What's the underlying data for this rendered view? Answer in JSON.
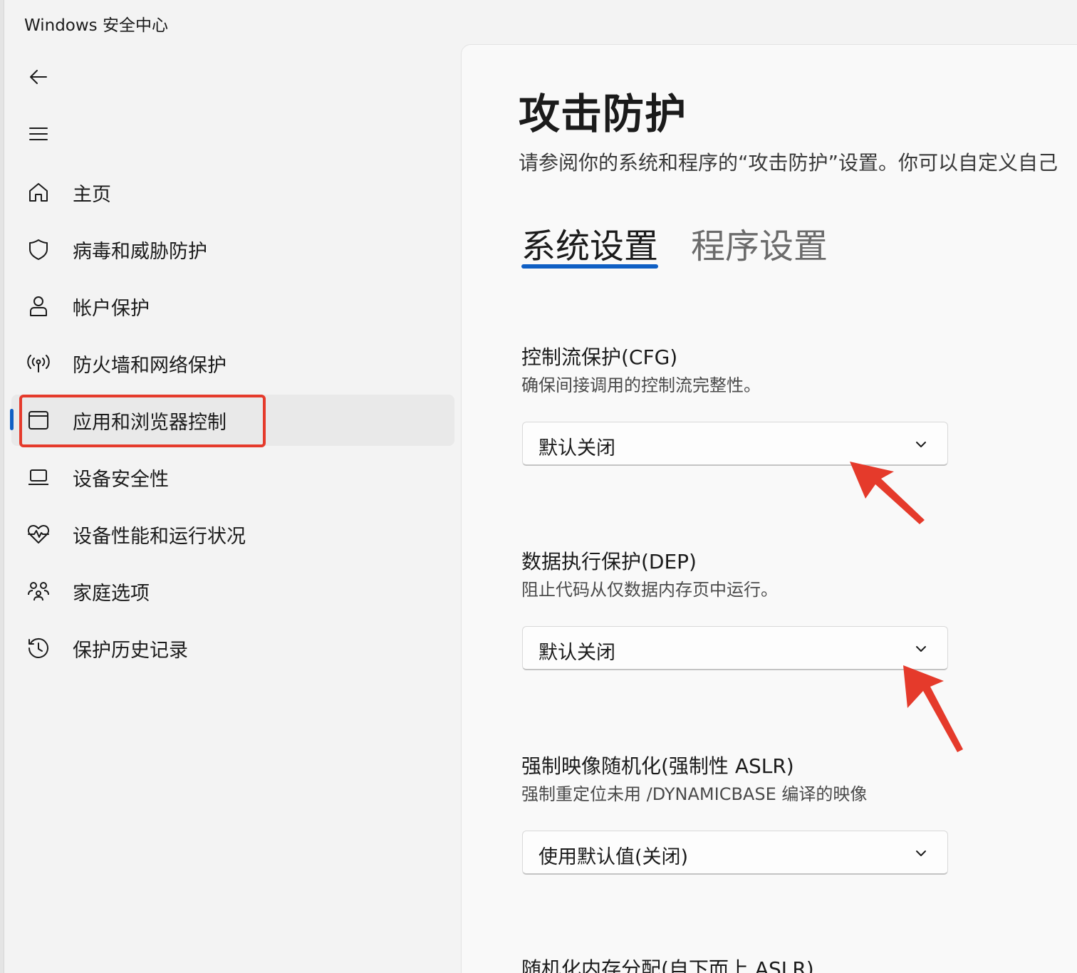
{
  "app": {
    "title": "Windows 安全中心"
  },
  "nav": {
    "back": "back-arrow-icon",
    "menu": "hamburger-menu-icon",
    "items": [
      {
        "label": "主页",
        "icon": "home-icon"
      },
      {
        "label": "病毒和威胁防护",
        "icon": "shield-icon"
      },
      {
        "label": "帐户保护",
        "icon": "person-icon"
      },
      {
        "label": "防火墙和网络保护",
        "icon": "antenna-icon"
      },
      {
        "label": "应用和浏览器控制",
        "icon": "app-window-icon",
        "selected": true
      },
      {
        "label": "设备安全性",
        "icon": "laptop-icon"
      },
      {
        "label": "设备性能和运行状况",
        "icon": "heart-pulse-icon"
      },
      {
        "label": "家庭选项",
        "icon": "family-icon"
      },
      {
        "label": "保护历史记录",
        "icon": "history-icon"
      }
    ]
  },
  "main": {
    "title": "攻击防护",
    "description": "请参阅你的系统和程序的“攻击防护”设置。你可以自定义自己",
    "tabs": [
      {
        "label": "系统设置",
        "active": true
      },
      {
        "label": "程序设置",
        "active": false
      }
    ],
    "settings": [
      {
        "title": "控制流保护(CFG)",
        "description": "确保间接调用的控制流完整性。",
        "value": "默认关闭"
      },
      {
        "title": "数据执行保护(DEP)",
        "description": "阻止代码从仅数据内存页中运行。",
        "value": "默认关闭"
      },
      {
        "title": "强制映像随机化(强制性 ASLR)",
        "description": "强制重定位未用 /DYNAMICBASE 编译的映像",
        "value": "使用默认值(关闭)"
      },
      {
        "title": "随机化内存分配(自下而上 ASLR)"
      }
    ]
  },
  "colors": {
    "accent": "#0f5fc4",
    "annotation": "#e53a2b"
  }
}
